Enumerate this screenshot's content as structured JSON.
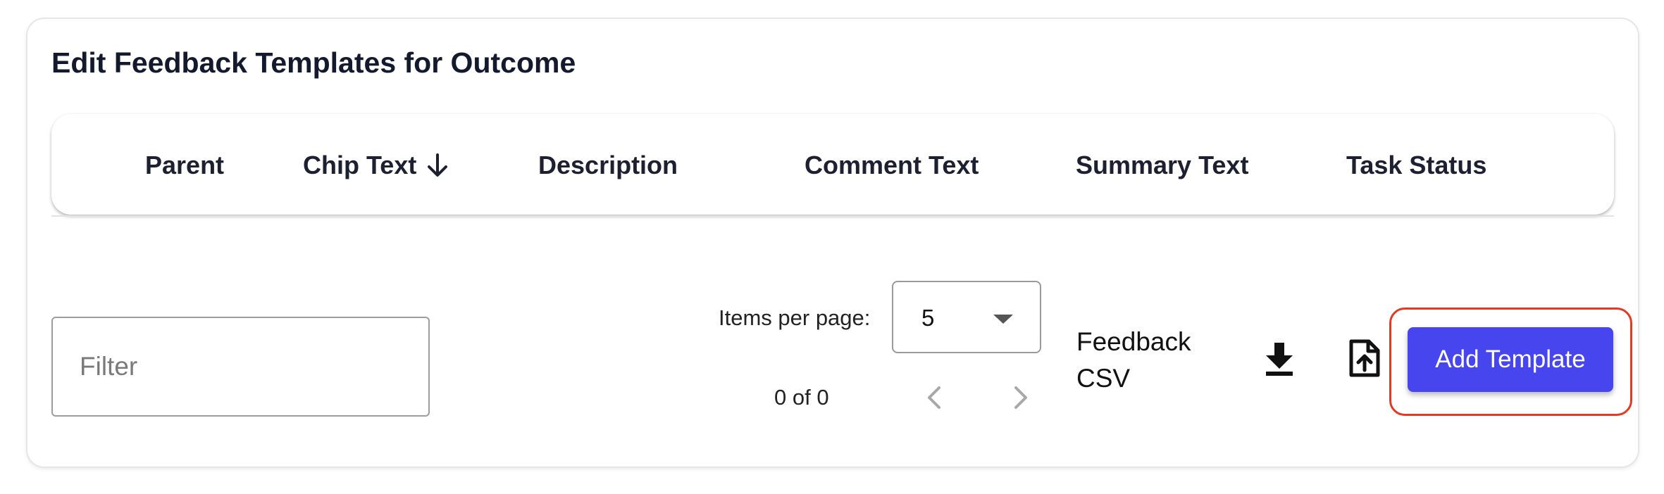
{
  "title": "Edit Feedback Templates for Outcome",
  "columns": [
    {
      "label": "Parent"
    },
    {
      "label": "Chip Text",
      "sort": "descending",
      "sort_icon": "arrow-down-icon"
    },
    {
      "label": "Description"
    },
    {
      "label": "Comment Text"
    },
    {
      "label": "Summary Text"
    },
    {
      "label": "Task Status"
    }
  ],
  "filter": {
    "placeholder": "Filter",
    "value": ""
  },
  "pagination": {
    "items_per_page_label": "Items per page:",
    "items_per_page_value": "5",
    "range_label": "0 of 0",
    "prev_icon": "chevron-left-icon",
    "next_icon": "chevron-right-icon"
  },
  "feedback_csv": {
    "label": "Feedback CSV",
    "download_icon": "download-icon",
    "upload_icon": "file-upload-icon"
  },
  "add_template_button": {
    "label": "Add Template"
  },
  "colors": {
    "primary_button": "#4745ee",
    "highlight_outline": "#e23b24",
    "title_text": "#141a2e"
  }
}
